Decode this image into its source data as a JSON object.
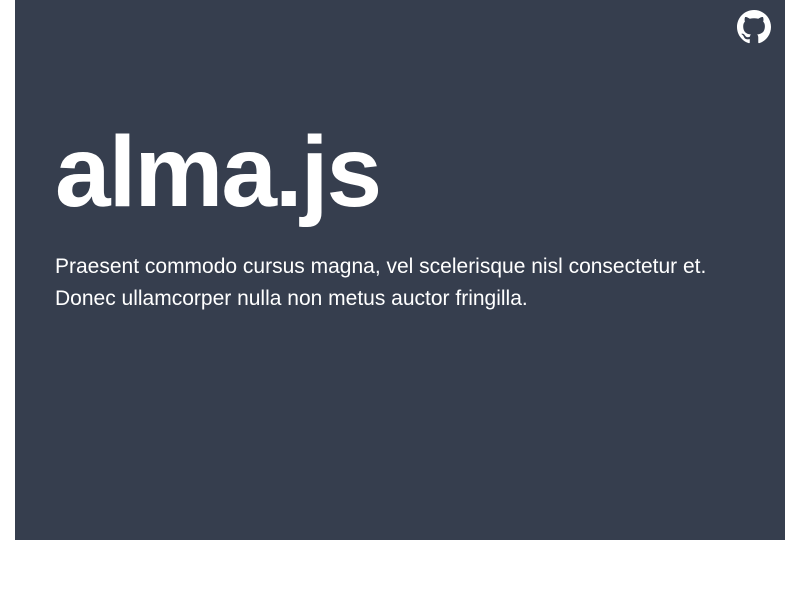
{
  "hero": {
    "title": "alma.js",
    "subtitle": "Praesent commodo cursus magna, vel scelerisque nisl consectetur et. Donec ullamcorper nulla non metus auctor fringilla."
  }
}
